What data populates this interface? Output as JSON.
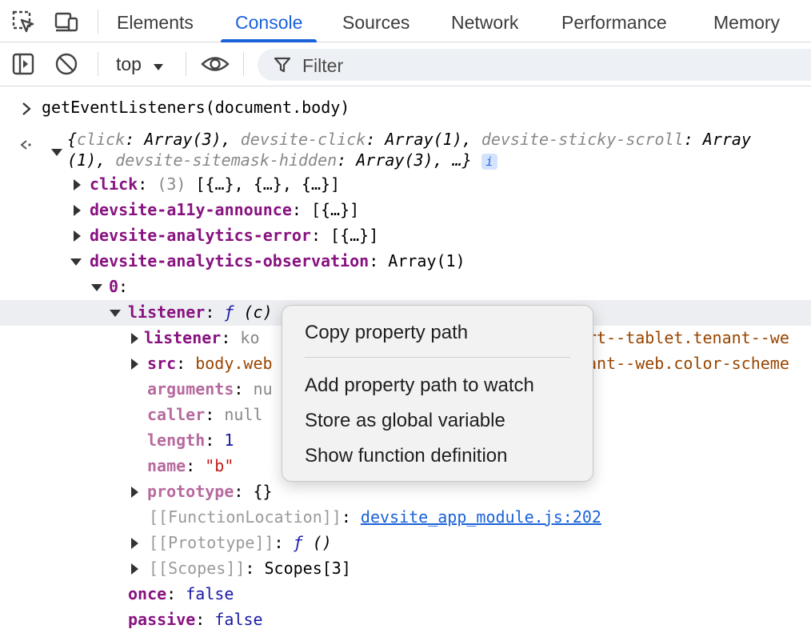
{
  "tabs": [
    "Elements",
    "Console",
    "Sources",
    "Network",
    "Performance",
    "Memory"
  ],
  "active_tab": "Console",
  "toolbar": {
    "context": "top",
    "filter_placeholder": "Filter"
  },
  "console": {
    "command": "getEventListeners(document.body)",
    "summary_line1": {
      "k1": "click",
      "v1": " Array(3), ",
      "k2": "devsite-click",
      "v2": " Array(1), ",
      "k3": "devsite-sticky-scroll",
      "v3": " Array"
    },
    "summary_line2": {
      "p1": "(1), ",
      "k4": "devsite-sitemask-hidden",
      "v4": " Array(3), …}"
    },
    "info_badge": "i",
    "rows": {
      "click": {
        "key": "click",
        "count": "(3)",
        "val": " [{…}, {…}, {…}]"
      },
      "a11y": {
        "key": "devsite-a11y-announce",
        "val": " [{…}]"
      },
      "analytics_error": {
        "key": "devsite-analytics-error",
        "val": " [{…}]"
      },
      "analytics_obs": {
        "key": "devsite-analytics-observation",
        "val": " Array(1)"
      },
      "index0": {
        "key": "0"
      },
      "listener": {
        "key": "listener",
        "f": "ƒ",
        "args": " (c)"
      },
      "listener_inner": {
        "key": "listener",
        "val": " ko",
        "tail": "rt--tablet.tenant--we"
      },
      "src": {
        "key": "src",
        "val": " body.web",
        "tail": "ant--web.color-scheme"
      },
      "arguments": {
        "key": "arguments",
        "val": " nu"
      },
      "caller": {
        "key": "caller",
        "val": " null"
      },
      "length": {
        "key": "length",
        "val": "1"
      },
      "name": {
        "key": "name",
        "val": "\"b\""
      },
      "prototype": {
        "key": "prototype",
        "val": " {}"
      },
      "function_location": {
        "key": "[[FunctionLocation]]",
        "link": "devsite_app_module.js:202"
      },
      "proto": {
        "key": "[[Prototype]]",
        "f": "ƒ",
        "args": " ()"
      },
      "scopes": {
        "key": "[[Scopes]]",
        "val": " Scopes[3]"
      },
      "once": {
        "key": "once",
        "val": "false"
      },
      "passive": {
        "key": "passive",
        "val": "false"
      }
    }
  },
  "context_menu": {
    "items": [
      "Copy property path",
      "Add property path to watch",
      "Store as global variable",
      "Show function definition"
    ]
  }
}
